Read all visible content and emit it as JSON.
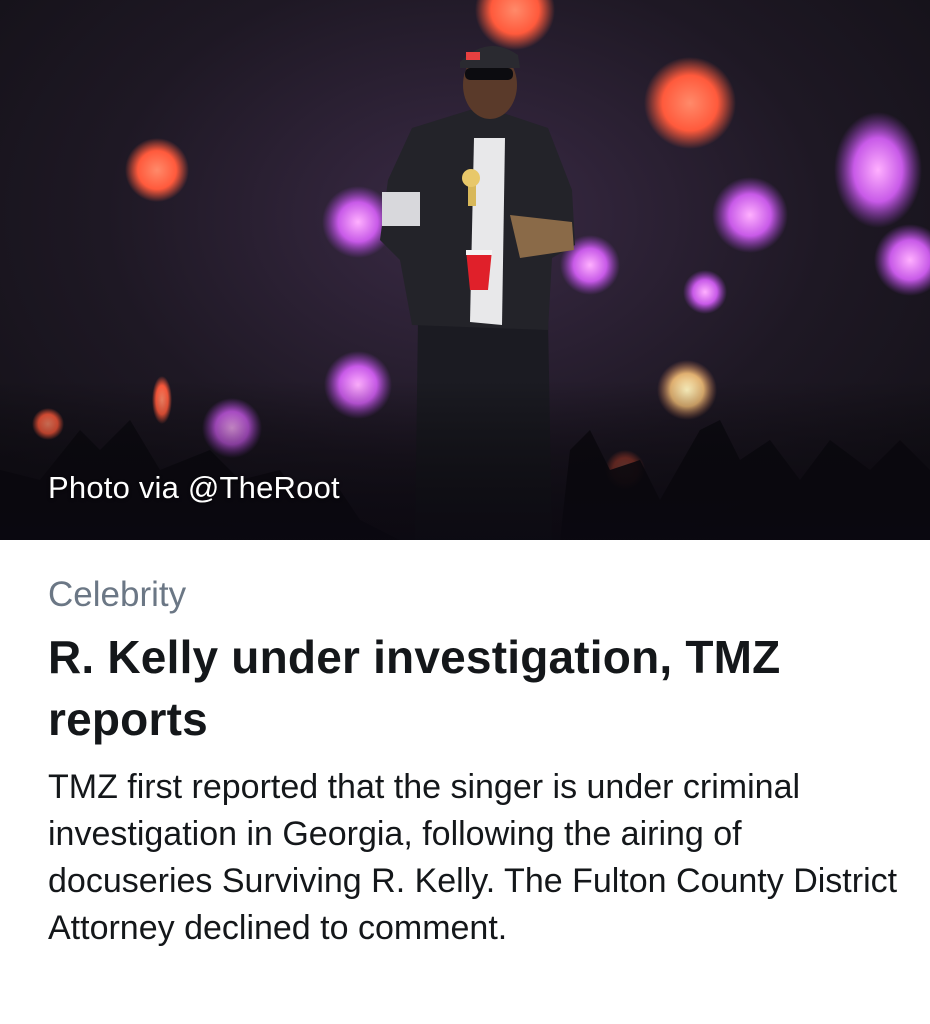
{
  "card": {
    "photo_credit": "Photo via @TheRoot",
    "category": "Celebrity",
    "headline": "R. Kelly under investigation, TMZ reports",
    "summary": "TMZ first reported that the singer is under criminal investigation in Georgia, following the airing of docuseries Surviving R. Kelly. The Fulton County District Attorney declined to comment."
  },
  "colors": {
    "category_text": "#6b7785",
    "headline_text": "#14171a",
    "background": "#ffffff"
  }
}
